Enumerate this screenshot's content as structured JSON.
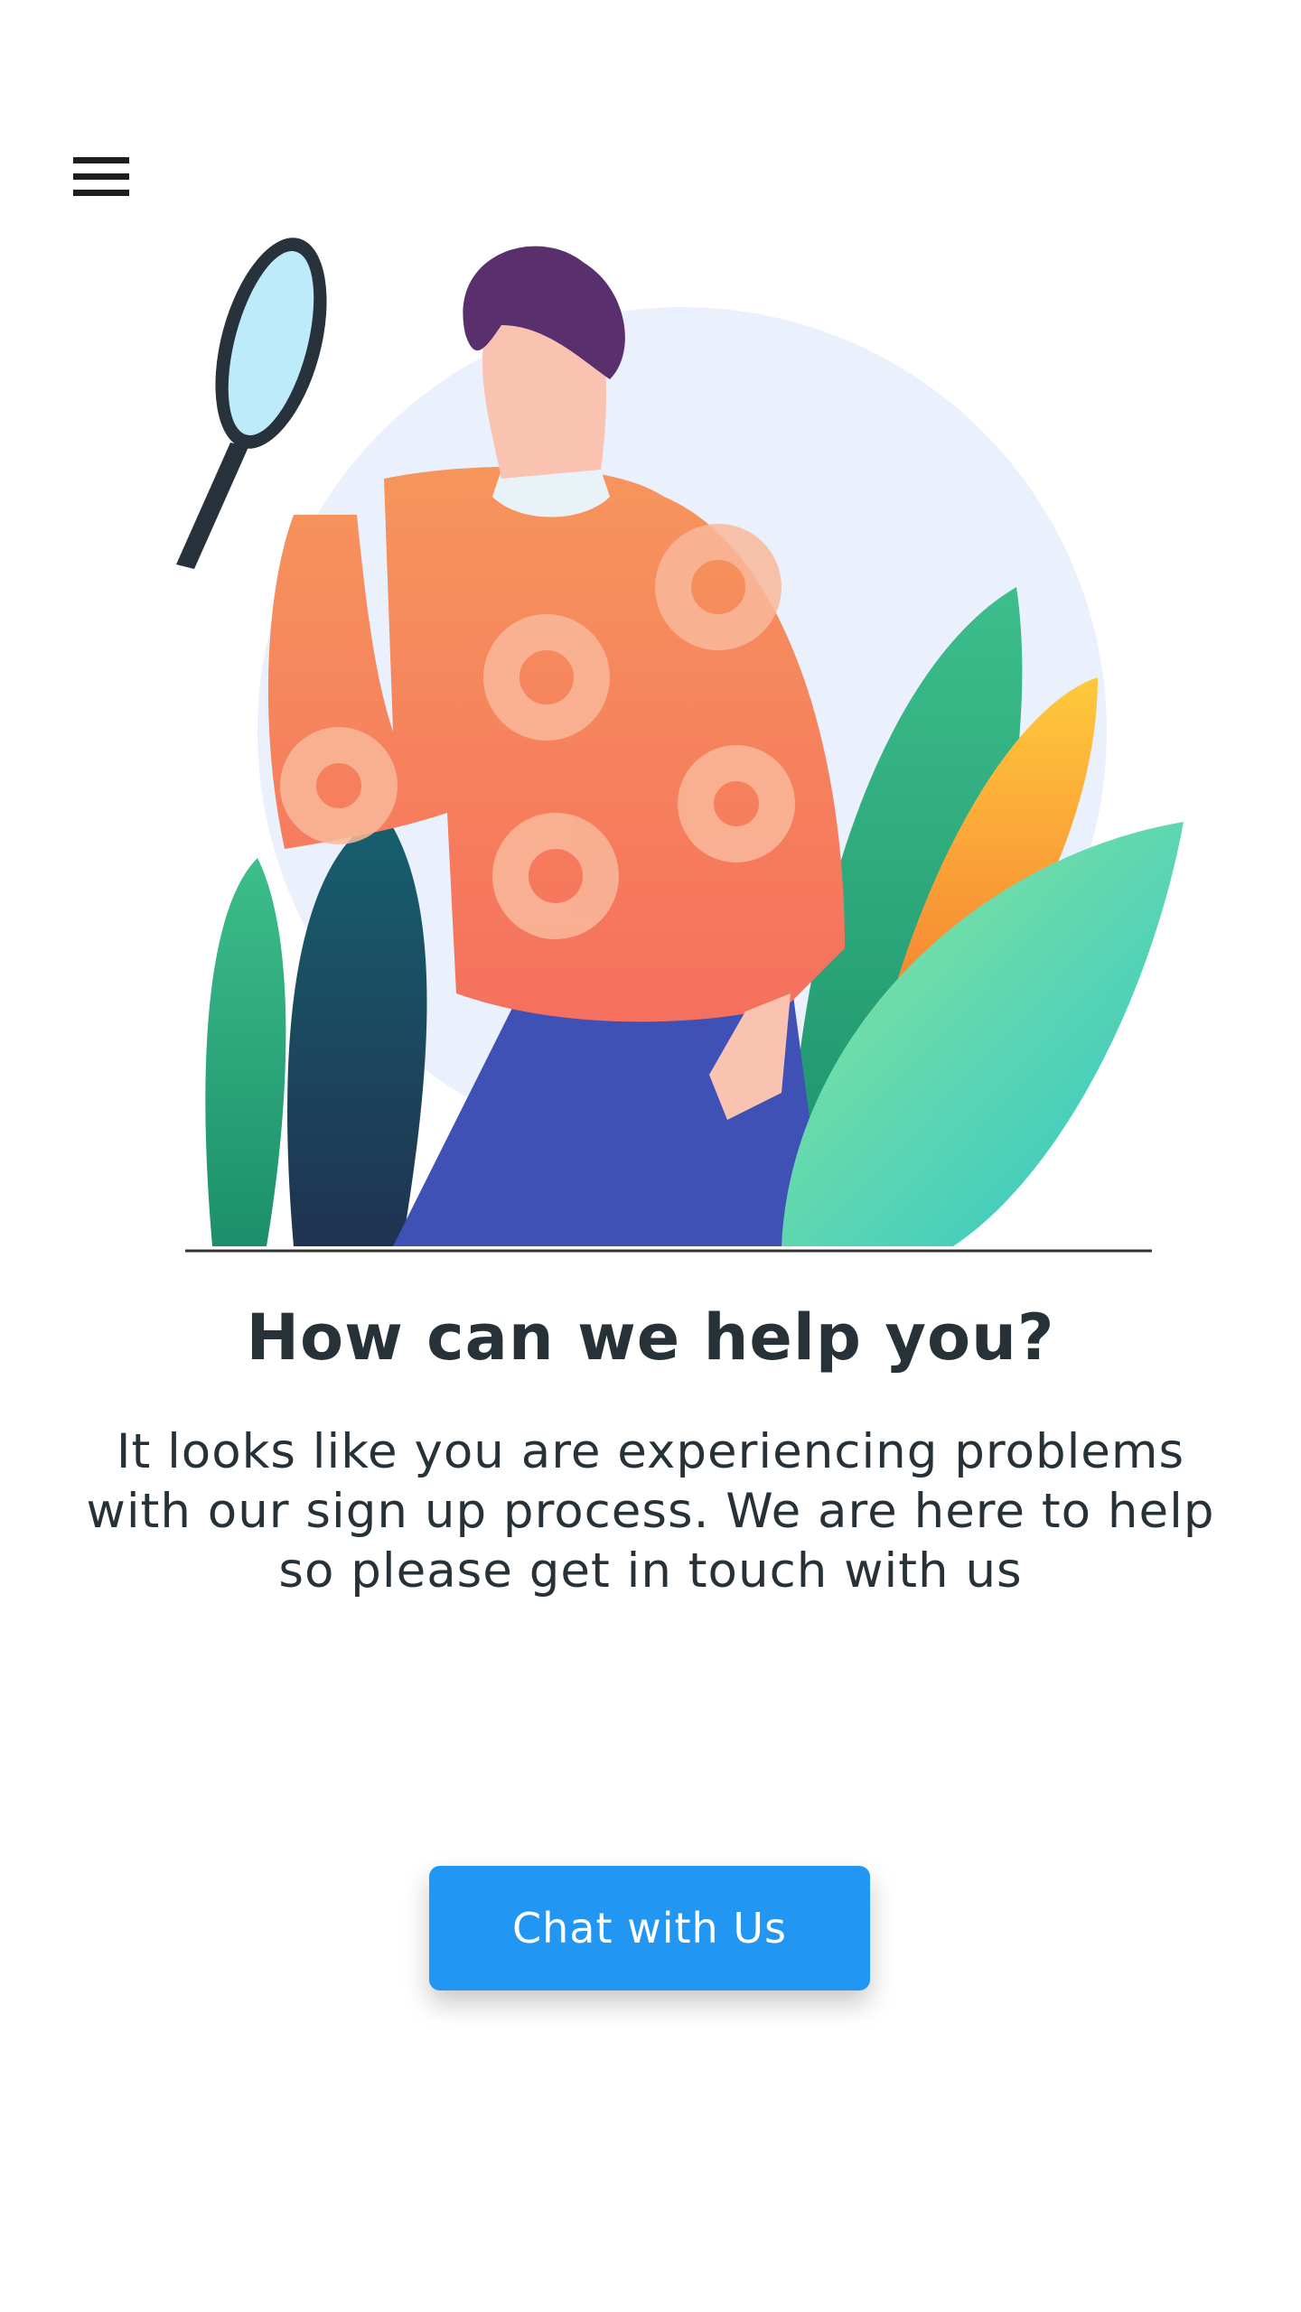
{
  "header": {
    "menu_icon": "hamburger-icon"
  },
  "illustration": {
    "subject": "person-with-magnifying-glass",
    "colors": {
      "sweater": "#F4845F",
      "pants": "#3F51B5",
      "background_circle": "#EBF0FD",
      "leaves": "#3DBE8B"
    }
  },
  "main": {
    "title": "How can we help you?",
    "description": "It looks like you are experiencing problems with our sign up process. We are here to help so please get in touch with us",
    "chat_button_label": "Chat with Us"
  },
  "colors": {
    "accent": "#2196F3",
    "text": "#263238"
  }
}
